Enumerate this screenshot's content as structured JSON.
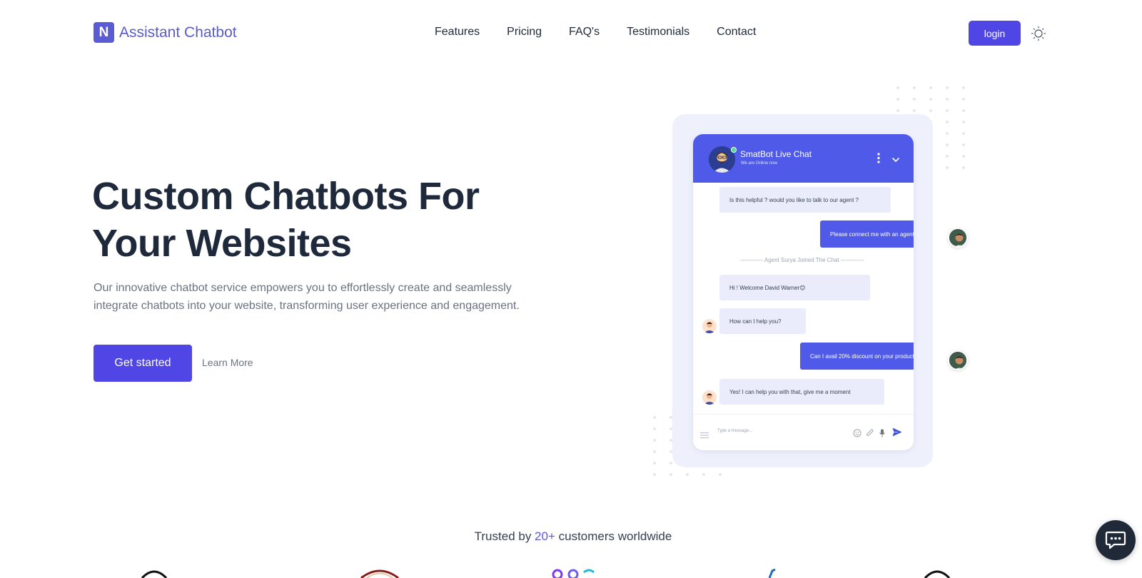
{
  "brand": {
    "logo_letter": "N",
    "name": "Assistant Chatbot"
  },
  "nav": {
    "links": [
      "Features",
      "Pricing",
      "FAQ's",
      "Testimonials",
      "Contact"
    ],
    "login_label": "login"
  },
  "hero": {
    "title_line1": "Custom Chatbots For",
    "title_line2": "Your Websites",
    "description": "Our innovative chatbot service empowers you to effortlessly create and seamlessly integrate chatbots into your website, transforming user experience and engagement.",
    "cta_label": "Get started",
    "secondary_label": "Learn More"
  },
  "chat": {
    "title": "SmatBot Live Chat",
    "status": "We are Online now",
    "messages": [
      "Is this helpful ? would you like to talk to our agent ?",
      "Please connect me with an agent",
      "------------ Agent Surya Joined The Chat ------------",
      "Hi ! Welcome David Warner😊",
      "How can I help you?",
      "Can I avail 20% discount on your product",
      "Yes! I can help you with that, give me a moment"
    ],
    "input_placeholder": "Type a message..."
  },
  "trusted": {
    "prefix": "Trusted by ",
    "highlight": "20+",
    "suffix": " customers worldwide"
  },
  "colors": {
    "accent": "#4f46e5",
    "brand_text": "#5a5bc9",
    "chat_header": "#4f5ae8",
    "fab": "#1f2937"
  },
  "icons": [
    "sun-icon",
    "chat-bubble-icon",
    "kebab-menu-icon",
    "chevron-down-icon",
    "emoji-icon",
    "paperclip-icon",
    "microphone-icon",
    "send-icon",
    "hamburger-icon"
  ]
}
